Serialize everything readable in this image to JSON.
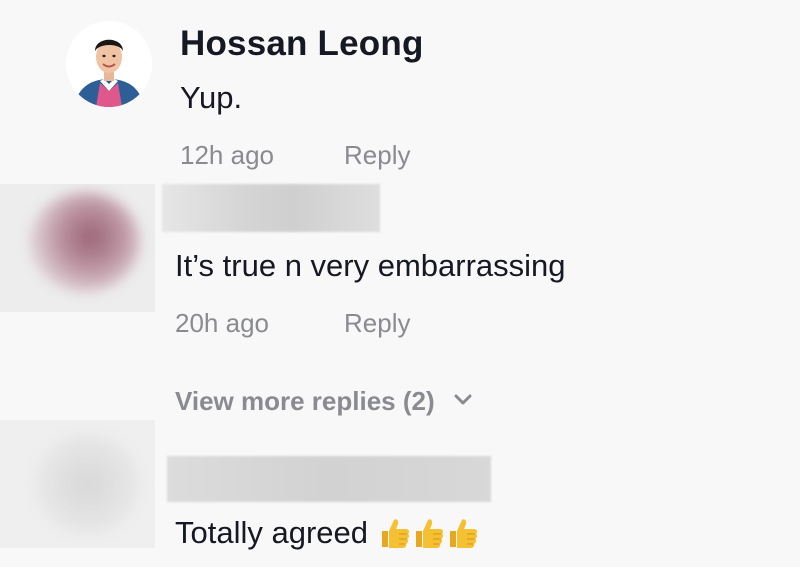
{
  "comments": [
    {
      "author": "Hossan Leong",
      "text": "Yup.",
      "time": "12h ago",
      "reply_label": "Reply",
      "avatar_icon": "user-avatar-photo"
    },
    {
      "author": "",
      "text": "It’s true n very embarrassing",
      "time": "20h ago",
      "reply_label": "Reply",
      "avatar_icon": "blurred-avatar"
    },
    {
      "author": "",
      "text": "Totally agreed",
      "emoji": [
        "thumbs-up",
        "thumbs-up",
        "thumbs-up"
      ],
      "avatar_icon": "blurred-avatar"
    }
  ],
  "view_more_replies": {
    "label": "View more replies (2)",
    "icon": "chevron-down-icon"
  },
  "colors": {
    "background": "#f8f8f8",
    "primary_text": "#161823",
    "secondary_text": "#8a8b91",
    "emoji_yellow": "#f6c033"
  }
}
